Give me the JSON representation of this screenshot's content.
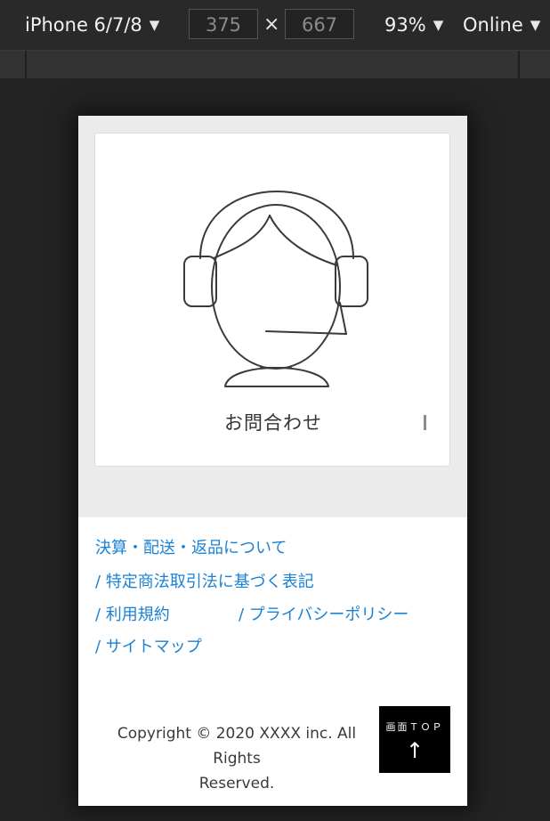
{
  "toolbar": {
    "device": "iPhone 6/7/8",
    "width": "375",
    "height": "667",
    "times": "×",
    "zoom": "93%",
    "network": "Online",
    "dropdown_icon": "triangle-down"
  },
  "contact": {
    "label": "お問合わせ",
    "icon": "headset-operator-icon"
  },
  "footer_links": [
    "決算・配送・返品について",
    "/ 特定商法取引法に基づく表記",
    "/ 利用規約",
    "/ プライバシーポリシー",
    "/ サイトマップ"
  ],
  "copyright": {
    "line1": "Copyright © 2020 XXXX inc. All Rights",
    "line2": "Reserved."
  },
  "top_button": {
    "label": "画面ＴＯＰ",
    "arrow": "↑"
  },
  "colors": {
    "link": "#1a82d6",
    "band": "#ebebeb",
    "top_button_bg": "#000000"
  }
}
